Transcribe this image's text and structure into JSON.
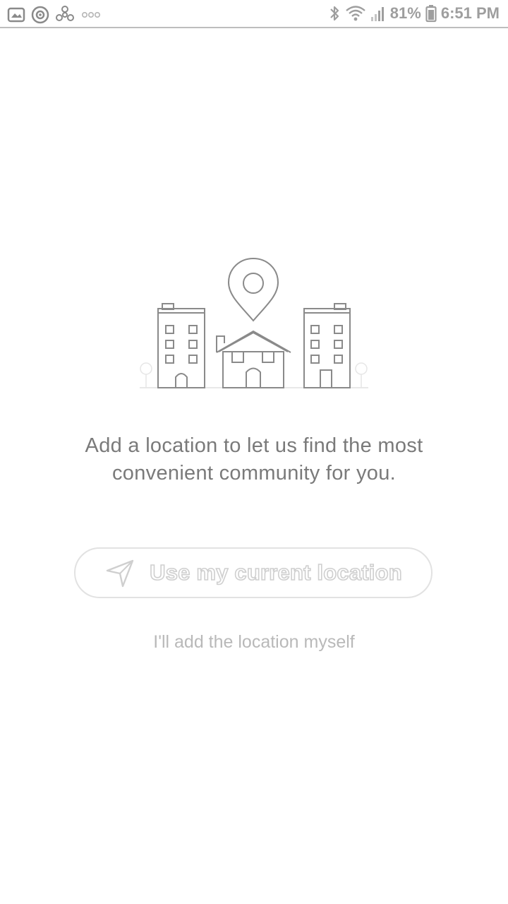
{
  "status_bar": {
    "battery": "81%",
    "time": "6:51 PM",
    "left_icons": [
      "image-notification-icon",
      "target-notification-icon",
      "fan-notification-icon",
      "more-notifications-icon"
    ],
    "right_icons": [
      "bluetooth-icon",
      "wifi-icon",
      "signal-icon",
      "battery-icon"
    ]
  },
  "illustration": {
    "icon": "location-buildings-illustration"
  },
  "main": {
    "message": "Add a location to let us find the most convenient community for you.",
    "use_location_button": "Use my current location",
    "use_location_icon": "navigation-arrow-icon",
    "manual_link": "I'll add the location myself"
  },
  "colors": {
    "text": "#7a7a7a",
    "button_border": "#e2e2e2",
    "link": "#b9b9b9",
    "status_text": "#9e9e9e"
  }
}
